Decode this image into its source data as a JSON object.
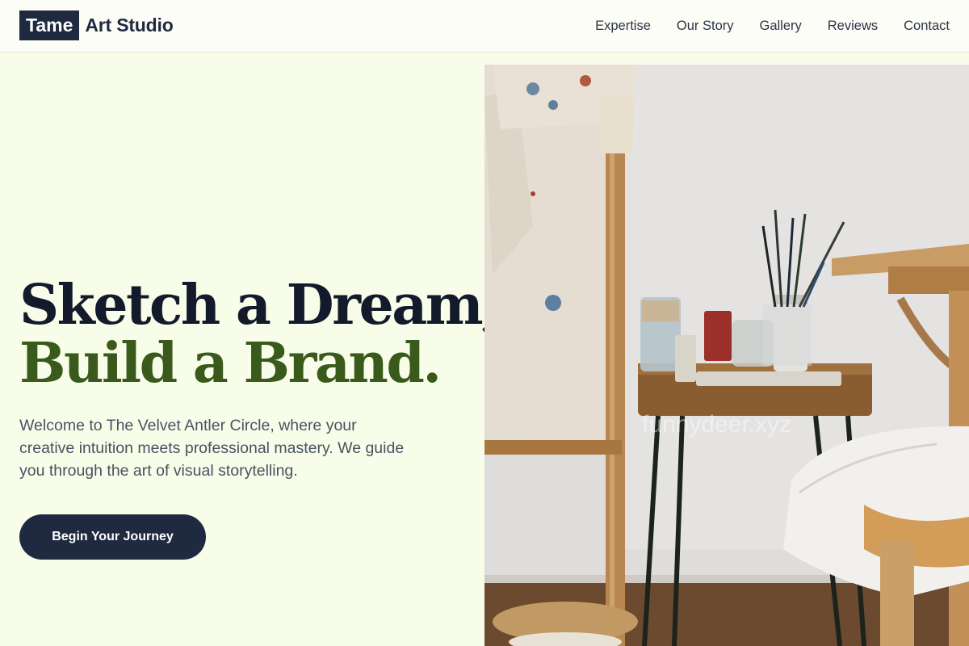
{
  "brand": {
    "box_text": "Tame",
    "text": "Art Studio"
  },
  "nav": {
    "items": [
      {
        "label": "Expertise"
      },
      {
        "label": "Our Story"
      },
      {
        "label": "Gallery"
      },
      {
        "label": "Reviews"
      },
      {
        "label": "Contact"
      }
    ]
  },
  "hero": {
    "title_line1": "Sketch a Dream,",
    "title_line2": "Build a Brand.",
    "description": "Welcome to The Velvet Antler Circle, where your creative intuition meets professional mastery. We guide you through the art of visual storytelling.",
    "cta_label": "Begin Your Journey",
    "image": {
      "subject": "artist studio with easel, small wooden side table holding paint brushes and bottles, white cloth draped over a stool",
      "watermark": "funnydeer.xyz"
    }
  },
  "colors": {
    "background": "#f7fde8",
    "navy": "#1f2a40",
    "accent_green": "#3a5a1b",
    "body_text": "#4a5262"
  }
}
